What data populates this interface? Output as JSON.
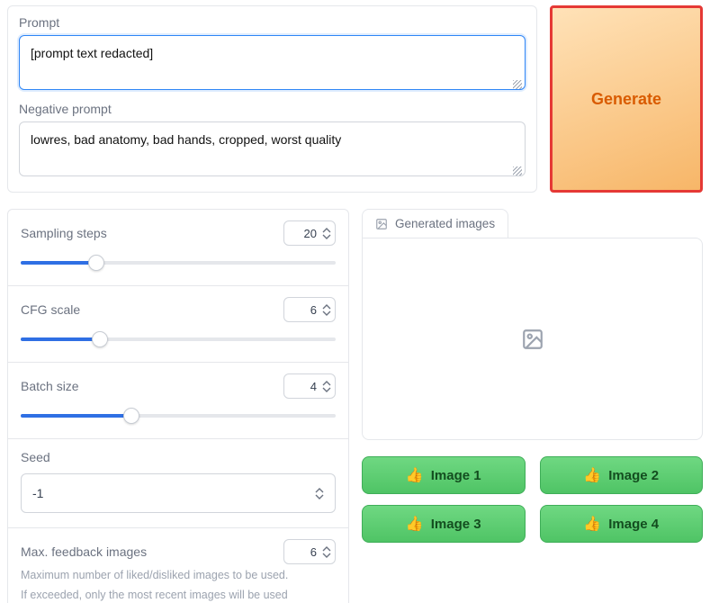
{
  "prompts": {
    "prompt_label": "Prompt",
    "prompt_value": "[prompt text redacted]",
    "negative_label": "Negative prompt",
    "negative_value": "lowres, bad anatomy, bad hands, cropped, worst quality"
  },
  "generate_label": "Generate",
  "settings": {
    "sampling": {
      "label": "Sampling steps",
      "value": "20",
      "pct": 24
    },
    "cfg": {
      "label": "CFG scale",
      "value": "6",
      "pct": 25
    },
    "batch": {
      "label": "Batch size",
      "value": "4",
      "pct": 35
    },
    "seed": {
      "label": "Seed",
      "value": "-1"
    },
    "maxfb": {
      "label": "Max. feedback images",
      "value": "6",
      "hint1": "Maximum number of liked/disliked images to be used.",
      "hint2": "If exceeded, only the most recent images will be used"
    }
  },
  "output": {
    "tab_label": "Generated images",
    "buttons": [
      "Image 1",
      "Image 2",
      "Image 3",
      "Image 4"
    ]
  }
}
